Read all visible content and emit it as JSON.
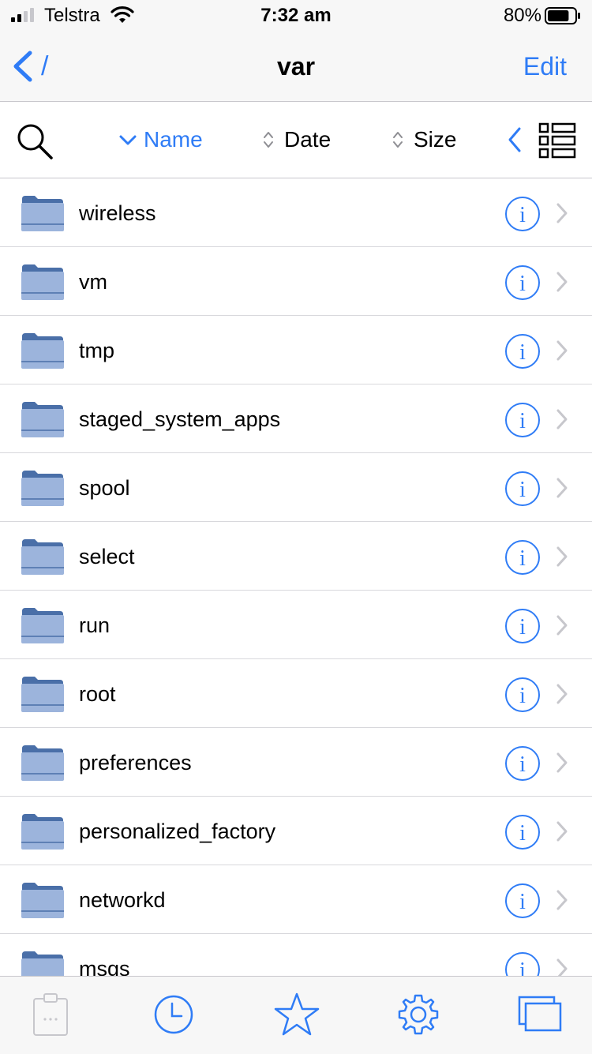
{
  "status_bar": {
    "carrier": "Telstra",
    "time": "7:32 am",
    "battery_percent": "80%",
    "battery_level": 0.8,
    "signal_bars": 2,
    "signal_icon": "cellular-signal-icon",
    "wifi_icon": "wifi-icon"
  },
  "nav": {
    "back_label": "/",
    "title": "var",
    "edit_label": "Edit"
  },
  "sort_bar": {
    "search_icon": "search-icon",
    "options": [
      {
        "label": "Name",
        "icon": "chevron-down-icon",
        "active": true
      },
      {
        "label": "Date",
        "icon": "sort-updown-icon",
        "active": false
      },
      {
        "label": "Size",
        "icon": "sort-updown-icon",
        "active": false
      }
    ],
    "collapse_icon": "chevron-left-icon",
    "layout_icon": "list-layout-icon"
  },
  "files": [
    {
      "name": "wireless"
    },
    {
      "name": "vm"
    },
    {
      "name": "tmp"
    },
    {
      "name": "staged_system_apps"
    },
    {
      "name": "spool"
    },
    {
      "name": "select"
    },
    {
      "name": "run"
    },
    {
      "name": "root"
    },
    {
      "name": "preferences"
    },
    {
      "name": "personalized_factory"
    },
    {
      "name": "networkd"
    },
    {
      "name": "msgs"
    }
  ],
  "tab_bar": {
    "tabs": [
      {
        "icon": "clipboard-icon",
        "active": false
      },
      {
        "icon": "clock-icon",
        "active": true
      },
      {
        "icon": "star-icon",
        "active": true
      },
      {
        "icon": "gear-icon",
        "active": true
      },
      {
        "icon": "windows-icon",
        "active": true
      }
    ]
  },
  "colors": {
    "accent": "#2f7cf6",
    "folder_body": "#9cb4dc",
    "folder_tab": "#4a6fa8",
    "bar_background": "#f7f7f7",
    "separator": "#c8c7cc",
    "inactive_icon": "#c7c7cc"
  }
}
